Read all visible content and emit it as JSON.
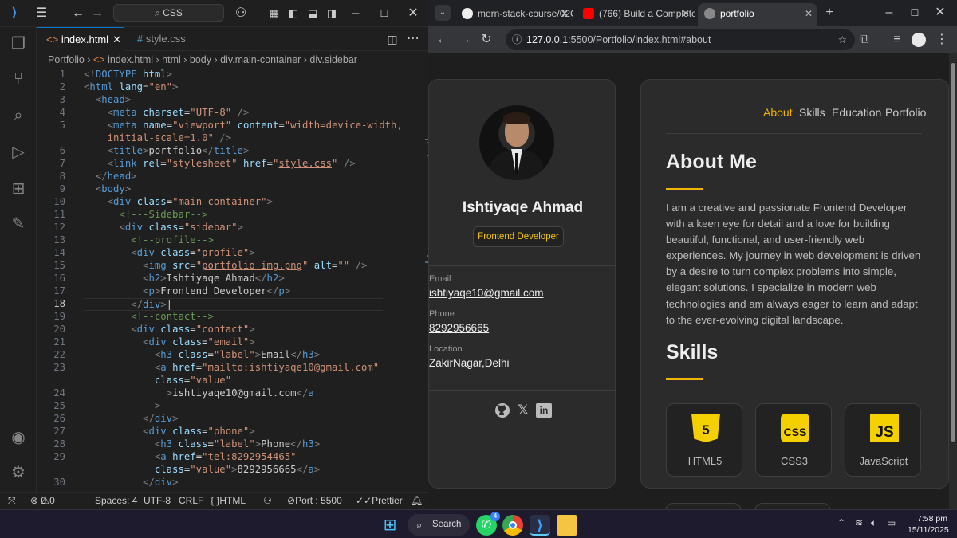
{
  "vscode": {
    "search_text": "CSS",
    "tabs": [
      {
        "label": "index.html",
        "active": true
      },
      {
        "label": "style.css",
        "active": false
      }
    ],
    "breadcrumb": [
      "Portfolio",
      "index.html",
      "html",
      "body",
      "div.main-container",
      "div.sidebar"
    ],
    "line_numbers": [
      "1",
      "2",
      "3",
      "4",
      "5",
      "",
      "6",
      "7",
      "8",
      "9",
      "10",
      "11",
      "12",
      "13",
      "14",
      "15",
      "16",
      "17",
      "18",
      "19",
      "20",
      "21",
      "22",
      "23",
      "",
      "24",
      "25",
      "26",
      "27",
      "28",
      "29",
      "",
      "30"
    ],
    "status": {
      "errors": "0",
      "warnings": "0",
      "spaces": "Spaces: 4",
      "encoding": "UTF-8",
      "eol": "CRLF",
      "language": "HTML",
      "port": "Port : 5500",
      "formatter": "Prettier"
    }
  },
  "browser": {
    "tabs": [
      {
        "label": "mern-stack-course/02C",
        "active": false
      },
      {
        "label": "(766) Build a Complete",
        "active": false
      },
      {
        "label": "portfolio",
        "active": true
      }
    ],
    "url_host": "127.0.0.1",
    "url_path": ":5500/Portfolio/index.html#about"
  },
  "portfolio": {
    "name": "Ishtiyaqe Ahmad",
    "role": "Frontend Developer",
    "contact": [
      {
        "label": "Email",
        "value": "ishtiyaqe10@gmail.com",
        "link": true
      },
      {
        "label": "Phone",
        "value": "8292956665",
        "link": true
      },
      {
        "label": "Location",
        "value": "ZakirNagar,Delhi",
        "link": false
      }
    ],
    "social_icons": [
      "github-icon",
      "x-icon",
      "linkedin-icon"
    ],
    "nav": [
      "About",
      "Skills",
      "Education",
      "Portfolio"
    ],
    "about_heading": "About Me",
    "about_text": "I am a creative and passionate Frontend Developer with a keen eye for detail and a love for building beautiful, functional, and user-friendly web experiences. My journey in web development is driven by a desire to turn complex problems into simple, elegant solutions. I specialize in modern web technologies and am always eager to learn and adapt to the ever-evolving digital landscape.",
    "skills_heading": "Skills",
    "skills": [
      {
        "name": "HTML5",
        "logo": "5"
      },
      {
        "name": "CSS3",
        "logo": "CSS"
      },
      {
        "name": "JavaScript",
        "logo": "JS"
      }
    ]
  },
  "taskbar": {
    "search_label": "Search",
    "whatsapp_badge": "4",
    "time": "7:58 pm",
    "date": "15/11/2025"
  },
  "colors": {
    "accent": "#f5b400",
    "vscode_blue": "#0078d4"
  }
}
